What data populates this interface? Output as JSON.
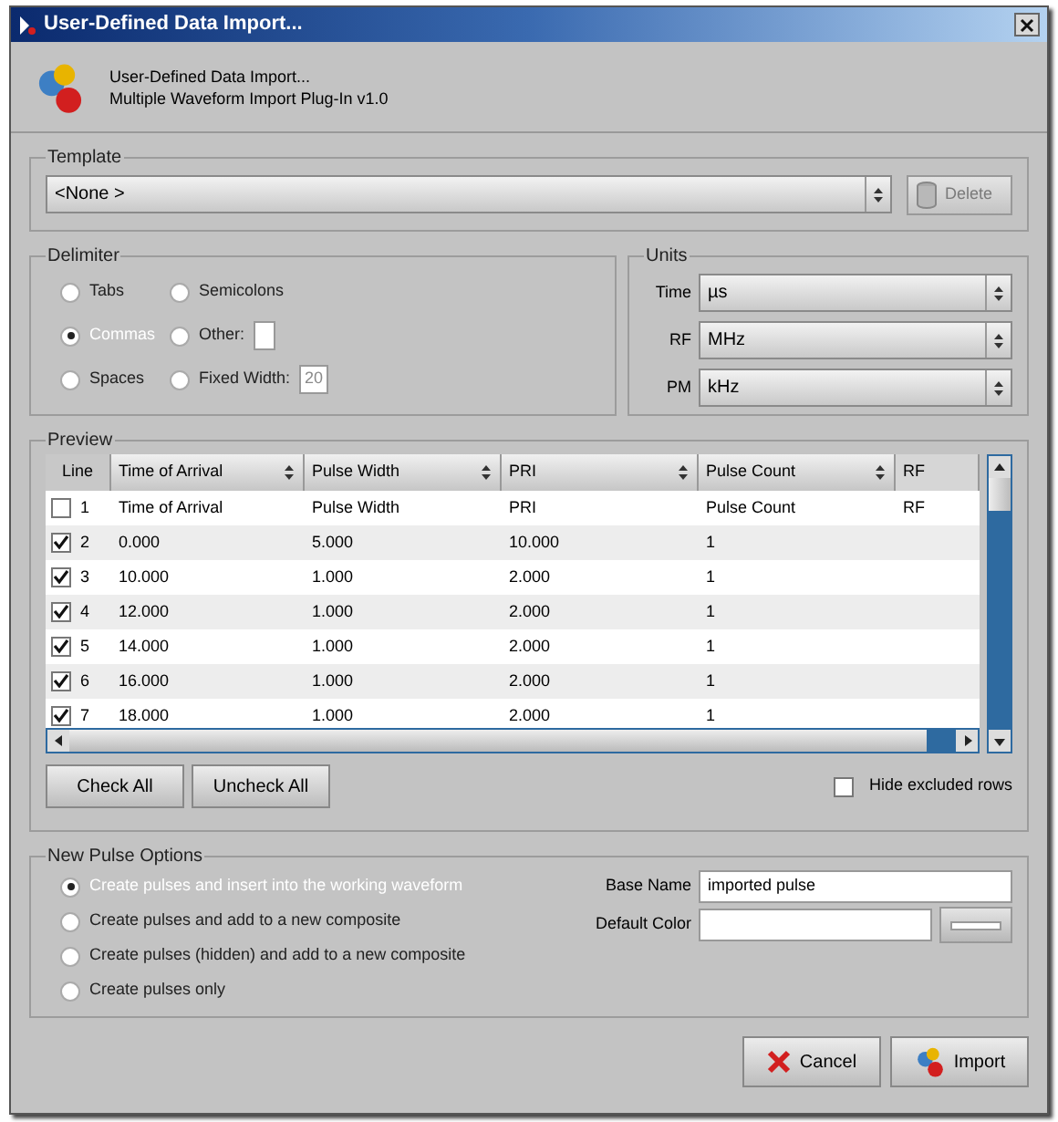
{
  "window": {
    "title": "User-Defined Data Import..."
  },
  "header": {
    "title": "User-Defined Data Import...",
    "subtitle": "Multiple Waveform Import Plug-In v1.0"
  },
  "template": {
    "label": "Template",
    "value": "<None >",
    "delete_button": {
      "label": "Delete",
      "disabled": true
    }
  },
  "delimiter": {
    "label": "Delimiter",
    "options": [
      {
        "label": "Tabs",
        "selected": false
      },
      {
        "label": "Semicolons",
        "selected": false
      },
      {
        "label": "Commas",
        "selected": true
      },
      {
        "label": "Other:",
        "selected": false,
        "kind": "field"
      },
      {
        "label": "Spaces",
        "selected": false
      },
      {
        "label": "Fixed Width:",
        "selected": false,
        "kind": "field",
        "field": {
          "value": "20",
          "disabled": true
        }
      }
    ]
  },
  "units": {
    "label": "Units",
    "items": [
      {
        "label": "Time",
        "value": "µs"
      },
      {
        "label": "RF",
        "value": "MHz"
      },
      {
        "label": "PM",
        "value": "kHz"
      }
    ]
  },
  "preview": {
    "label": "Preview",
    "line_header": "Line",
    "columns": [
      {
        "label": "Time of Arrival",
        "sortable": true
      },
      {
        "label": "Pulse Width",
        "sortable": true
      },
      {
        "label": "PRI",
        "sortable": true
      },
      {
        "label": "Pulse Count",
        "sortable": true
      },
      {
        "label": "RF",
        "sortable": false
      }
    ],
    "rows": [
      {
        "checked": false,
        "line": "1",
        "cells": [
          "Time of Arrival",
          "Pulse Width",
          "PRI",
          "Pulse Count",
          "RF"
        ]
      },
      {
        "checked": true,
        "line": "2",
        "cells": [
          "0.000",
          "5.000",
          "10.000",
          "1"
        ]
      },
      {
        "checked": true,
        "line": "3",
        "cells": [
          "10.000",
          "1.000",
          "2.000",
          "1"
        ]
      },
      {
        "checked": true,
        "line": "4",
        "cells": [
          "12.000",
          "1.000",
          "2.000",
          "1"
        ]
      },
      {
        "checked": true,
        "line": "5",
        "cells": [
          "14.000",
          "1.000",
          "2.000",
          "1"
        ]
      },
      {
        "checked": true,
        "line": "6",
        "cells": [
          "16.000",
          "1.000",
          "2.000",
          "1"
        ]
      },
      {
        "checked": true,
        "line": "7",
        "cells": [
          "18.000",
          "1.000",
          "2.000",
          "1"
        ]
      }
    ],
    "buttons": [
      "Check All",
      "Uncheck All"
    ],
    "hide_excluded": {
      "label": "Hide excluded rows",
      "checked": false
    }
  },
  "new_pulse_options": {
    "label": "New Pulse Options",
    "options": [
      {
        "label": "Create pulses and insert into the working waveform",
        "selected": true
      },
      {
        "label": "Create pulses and add to a new composite",
        "selected": false
      },
      {
        "label": "Create pulses (hidden) and add to a new composite",
        "selected": false
      },
      {
        "label": "Create pulses only",
        "selected": false
      }
    ],
    "base_name": {
      "label": "Base Name",
      "value": "imported pulse"
    },
    "default_color": {
      "label": "Default Color"
    }
  },
  "buttons": [
    {
      "label": "Cancel",
      "kind": "cancel"
    },
    {
      "label": "Import",
      "kind": "import"
    }
  ]
}
